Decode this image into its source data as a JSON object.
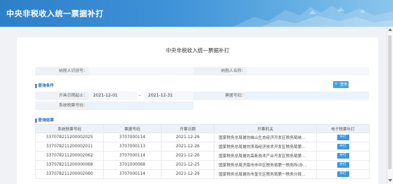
{
  "header": {
    "title": "中央非税收入统一票据补打"
  },
  "page_title": "中央非税收入统一票据补打",
  "form": {
    "payer_id_label": "纳税人识别号：",
    "payer_id_value": "",
    "payer_name_label": "纳税人名称：",
    "payer_name_value": ""
  },
  "query": {
    "section_title": "查询条件",
    "button_label": "查询",
    "date_label": "开具日期起止：",
    "date_from": "2021-12-01",
    "date_sep": "-",
    "date_to": "2021-12-31",
    "ticket_no_label": "票据号码：",
    "ticket_no_value": "",
    "sys_no_label": "系统税票号码：",
    "sys_no_value": ""
  },
  "results": {
    "section_title": "查询结果",
    "columns": [
      "系统税票号码",
      "票据号码",
      "开票日期",
      "开票机关",
      "电子税票补打"
    ],
    "rows": [
      {
        "sys_no": "337078211200002025",
        "ticket_no": "3707000114",
        "date": "2021-12-26",
        "authority": "国家税务总局潍坊峡山生态经济开发区税务局纳...",
        "action": "补打"
      },
      {
        "sys_no": "337078211200002011",
        "ticket_no": "3707000113",
        "date": "2021-12-26",
        "authority": "国家税务总局潍坊滨海经济技术开发区税务局第...",
        "action": "补打"
      },
      {
        "sys_no": "337078211200002062",
        "ticket_no": "3707000114",
        "date": "2021-12-26",
        "authority": "国家税务总局潍坊高新技术产业开发区税务局第...",
        "action": "补打"
      },
      {
        "sys_no": "337078211200000068",
        "ticket_no": "3701000068",
        "date": "2021-12-25",
        "authority": "国家税务总局济南市市中区税务局第一税务所(办...",
        "action": "补打"
      },
      {
        "sys_no": "337078211200002060",
        "ticket_no": "3707000114",
        "date": "2021-12-29",
        "authority": "国家税务总局潍坊市奎文区税务局第一税务分局...",
        "action": "补打"
      }
    ]
  }
}
